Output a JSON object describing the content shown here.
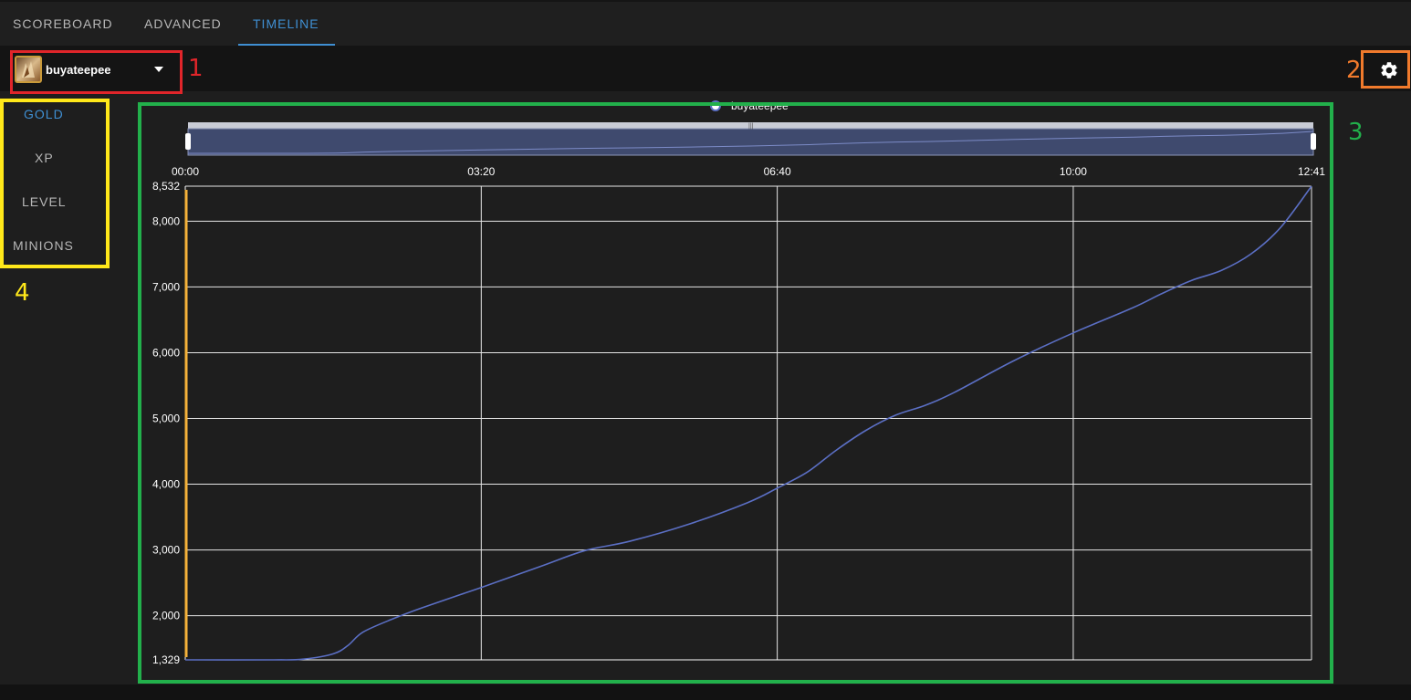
{
  "tabs": [
    {
      "label": "SCOREBOARD",
      "active": false
    },
    {
      "label": "ADVANCED",
      "active": false
    },
    {
      "label": "TIMELINE",
      "active": true
    }
  ],
  "player": {
    "name": "buyateepee",
    "icon": "champion-portrait"
  },
  "settings": {
    "icon": "gear-icon"
  },
  "stats_menu": [
    {
      "label": "GOLD",
      "active": true
    },
    {
      "label": "XP",
      "active": false
    },
    {
      "label": "LEVEL",
      "active": false
    },
    {
      "label": "MINIONS",
      "active": false
    }
  ],
  "annotations": [
    {
      "number": "1",
      "color": "#e0252a"
    },
    {
      "number": "2",
      "color": "#f07a2c"
    },
    {
      "number": "3",
      "color": "#22b04b"
    },
    {
      "number": "4",
      "color": "#ffe81a"
    }
  ],
  "colors": {
    "accent": "#3f8fd2",
    "series": "#5b6fc4",
    "marker": "#f5b23a"
  },
  "chart_data": {
    "type": "line",
    "legend": [
      "buyateepee"
    ],
    "xlabel": "",
    "ylabel": "",
    "x_ticks": [
      "00:00",
      "03:20",
      "06:40",
      "10:00",
      "12:41"
    ],
    "y_ticks": [
      "8,532",
      "8,000",
      "7,000",
      "6,000",
      "5,000",
      "4,000",
      "3,000",
      "2,000",
      "1,329"
    ],
    "ylim": [
      1329,
      8532
    ],
    "xlim_seconds": [
      0,
      761
    ],
    "grid": true,
    "series": [
      {
        "name": "buyateepee",
        "x_seconds": [
          0,
          60,
          80,
          100,
          110,
          120,
          140,
          160,
          200,
          240,
          270,
          300,
          340,
          380,
          400,
          420,
          440,
          460,
          480,
          500,
          520,
          560,
          600,
          640,
          660,
          680,
          700,
          720,
          740,
          761
        ],
        "values": [
          1329,
          1329,
          1340,
          1420,
          1550,
          1750,
          1950,
          2120,
          2430,
          2750,
          2990,
          3130,
          3390,
          3720,
          3940,
          4180,
          4520,
          4820,
          5050,
          5200,
          5400,
          5880,
          6300,
          6680,
          6900,
          7100,
          7250,
          7500,
          7900,
          8532
        ]
      }
    ]
  }
}
